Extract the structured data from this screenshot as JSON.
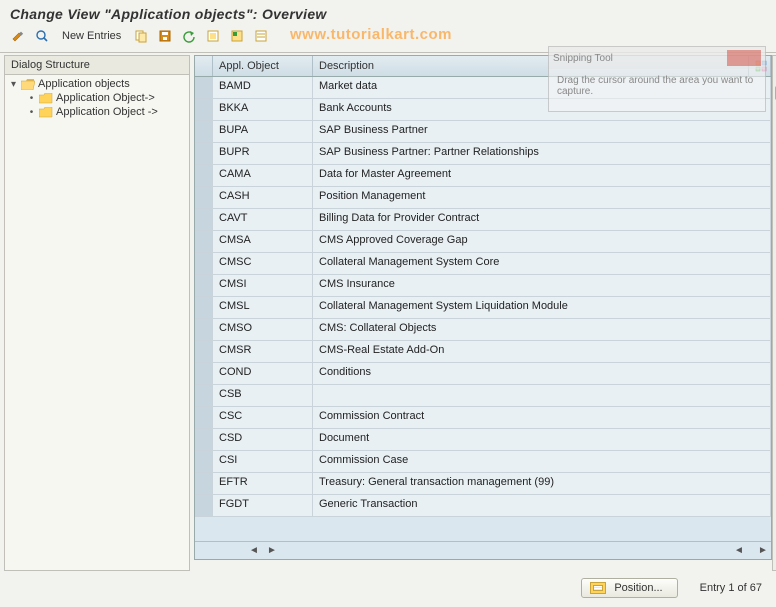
{
  "title": "Change View \"Application objects\": Overview",
  "watermark": "www.tutorialkart.com",
  "toolbar": {
    "new_entries": "New Entries"
  },
  "sidebar": {
    "header": "Dialog Structure",
    "root": "Application objects",
    "children": [
      "Application Object->",
      "Application Object ->"
    ]
  },
  "table": {
    "col_obj": "Appl. Object",
    "col_desc": "Description",
    "rows": [
      {
        "obj": "BAMD",
        "desc": "Market data"
      },
      {
        "obj": "BKKA",
        "desc": "Bank Accounts"
      },
      {
        "obj": "BUPA",
        "desc": "SAP Business Partner"
      },
      {
        "obj": "BUPR",
        "desc": "SAP Business Partner: Partner Relationships"
      },
      {
        "obj": "CAMA",
        "desc": "Data for Master Agreement"
      },
      {
        "obj": "CASH",
        "desc": "Position Management"
      },
      {
        "obj": "CAVT",
        "desc": "Billing Data for Provider Contract"
      },
      {
        "obj": "CMSA",
        "desc": "CMS Approved Coverage Gap"
      },
      {
        "obj": "CMSC",
        "desc": "Collateral Management System Core"
      },
      {
        "obj": "CMSI",
        "desc": "CMS Insurance"
      },
      {
        "obj": "CMSL",
        "desc": "Collateral Management System Liquidation Module"
      },
      {
        "obj": "CMSO",
        "desc": "CMS: Collateral Objects"
      },
      {
        "obj": "CMSR",
        "desc": "CMS-Real Estate Add-On"
      },
      {
        "obj": "COND",
        "desc": "Conditions"
      },
      {
        "obj": "CSB",
        "desc": ""
      },
      {
        "obj": "CSC",
        "desc": "Commission Contract"
      },
      {
        "obj": "CSD",
        "desc": "Document"
      },
      {
        "obj": "CSI",
        "desc": "Commission Case"
      },
      {
        "obj": "EFTR",
        "desc": "Treasury: General transaction management (99)"
      },
      {
        "obj": "FGDT",
        "desc": "Generic Transaction"
      }
    ]
  },
  "footer": {
    "position_btn": "Position...",
    "entry_text": "Entry 1 of 67"
  },
  "snip": {
    "title": "Snipping Tool",
    "hint": "Drag the cursor around the area you want to capture."
  }
}
